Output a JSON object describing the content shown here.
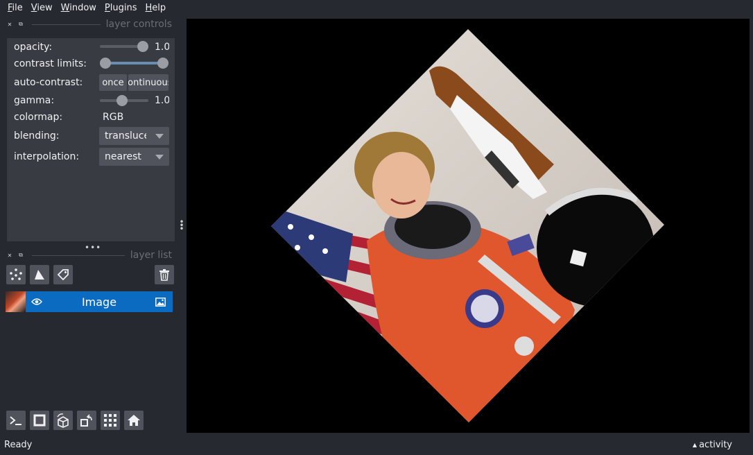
{
  "menu": [
    {
      "label_ul": "F",
      "label_rest": "ile"
    },
    {
      "label_ul": "V",
      "label_rest": "iew"
    },
    {
      "label_ul": "W",
      "label_rest": "indow"
    },
    {
      "label_ul": "P",
      "label_rest": "lugins"
    },
    {
      "label_ul": "H",
      "label_rest": "elp"
    }
  ],
  "layer_controls": {
    "title": "layer controls",
    "opacity_label": "opacity:",
    "opacity_value": "1.0",
    "opacity_level": 1.0,
    "contrast_label": "contrast limits:",
    "contrast_range": [
      0.0,
      1.0
    ],
    "auto_contrast_label": "auto-contrast:",
    "auto_once": "once",
    "auto_continuous": "continuous",
    "gamma_label": "gamma:",
    "gamma_value": "1.0",
    "colormap_label": "colormap:",
    "colormap_value": "RGB",
    "blending_label": "blending:",
    "blending_value": "translucent",
    "interpolation_label": "interpolation:",
    "interpolation_value": "nearest"
  },
  "layer_list": {
    "title": "layer list",
    "layers": [
      {
        "name": "Image",
        "visible": true,
        "selected": true
      }
    ]
  },
  "status": {
    "text": "Ready",
    "activity": "activity"
  },
  "colors": {
    "selected_layer": "#0a6bc1",
    "background": "#262930",
    "panel": "#383b42"
  },
  "icons": [
    "points-icon",
    "shapes-icon",
    "labels-icon",
    "trash-icon",
    "eye-icon",
    "image-type-icon",
    "console-icon",
    "square-icon",
    "3d-cube-icon",
    "rotate-icon",
    "grid-icon",
    "home-icon"
  ]
}
